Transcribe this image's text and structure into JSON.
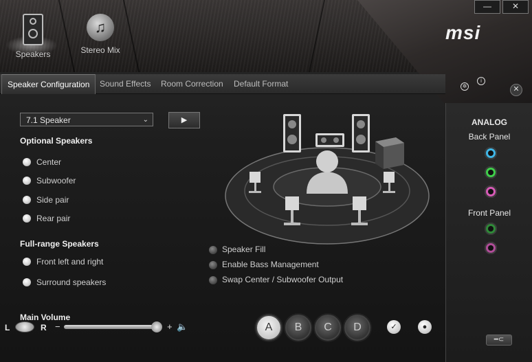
{
  "window": {
    "minimize_glyph": "—",
    "close_glyph": "✕"
  },
  "brand": {
    "logo_text": "msi"
  },
  "top_tabs": [
    {
      "label": "Speakers",
      "active": true,
      "icon": "speaker-icon"
    },
    {
      "label": "Stereo Mix",
      "active": false,
      "icon": "music-note-icon"
    }
  ],
  "sub_tabs": [
    {
      "label": "Speaker Configuration",
      "active": true
    },
    {
      "label": "Sound Effects",
      "active": false
    },
    {
      "label": "Room Correction",
      "active": false
    },
    {
      "label": "Default Format",
      "active": false
    }
  ],
  "speaker_config": {
    "selected": "7.1 Speaker",
    "play_glyph": "▶",
    "optional_title": "Optional Speakers",
    "optional": [
      "Center",
      "Subwoofer",
      "Side pair",
      "Rear pair"
    ],
    "fullrange_title": "Full-range Speakers",
    "fullrange": [
      "Front left and right",
      "Surround speakers"
    ],
    "options": [
      "Speaker Fill",
      "Enable Bass Management",
      "Swap Center / Subwoofer Output"
    ]
  },
  "volume": {
    "title": "Main Volume",
    "left": "L",
    "right": "R",
    "minus": "−",
    "plus": "+",
    "level": 0.95
  },
  "devices": [
    "A",
    "B",
    "C",
    "D"
  ],
  "active_device": "A",
  "right_panel": {
    "title": "ANALOG",
    "back_title": "Back Panel",
    "front_title": "Front Panel",
    "back_jacks": [
      "#3fb6e6",
      "#3fcf4a",
      "#d65ab6"
    ],
    "front_jacks": [
      "#2f8a38",
      "#b04c98"
    ]
  }
}
